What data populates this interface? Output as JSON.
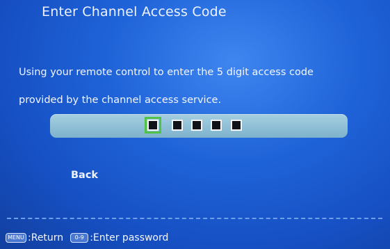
{
  "dialog": {
    "title": "Enter Channel Access Code",
    "instruction_line1": "Using your remote control to enter the 5 digit access code",
    "instruction_line2": "provided by the channel access service."
  },
  "code_entry": {
    "digit_count": 5,
    "focused_digit": 1
  },
  "menu": {
    "back_label": "Back"
  },
  "footer": {
    "menu_key": "MENU",
    "return_label": ":Return",
    "digits_key": "0-9",
    "enter_label": ":Enter password"
  },
  "colors": {
    "background": "#1f63d8",
    "code_bar": "#8fbfd6",
    "focus_outline": "#52c24a"
  }
}
